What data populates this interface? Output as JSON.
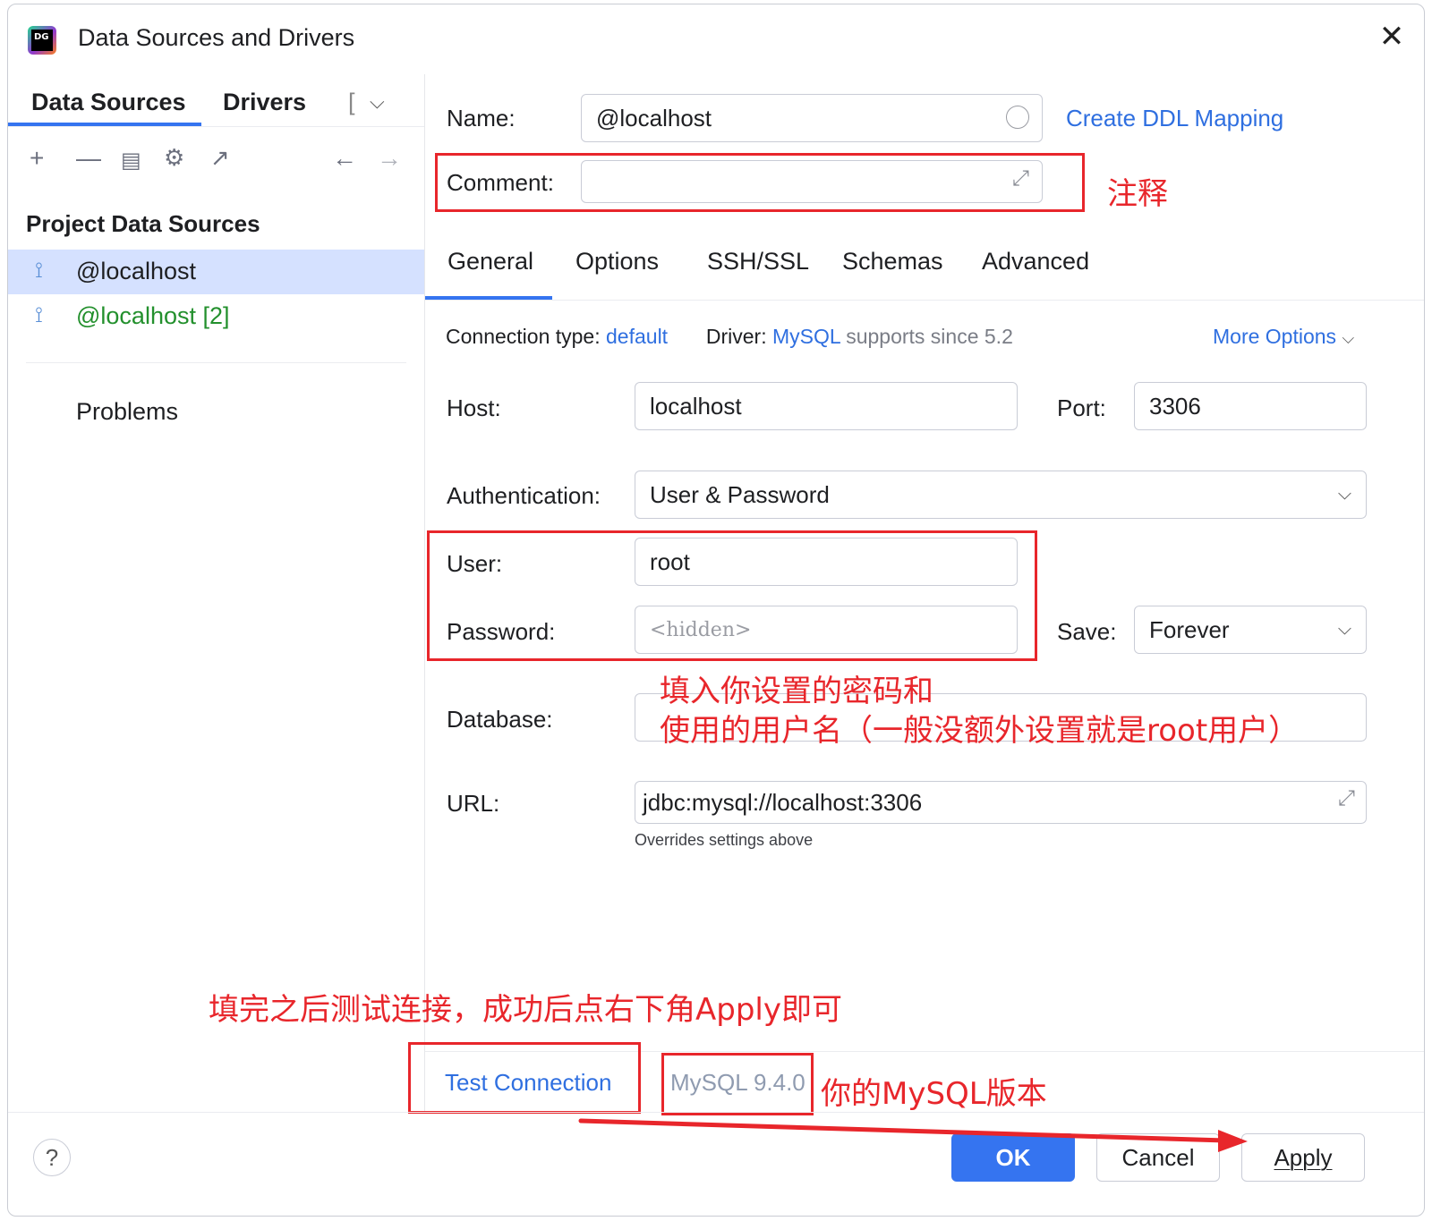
{
  "window": {
    "title": "Data Sources and Drivers",
    "app_icon_text": "DG"
  },
  "left": {
    "tabs": [
      "Data Sources",
      "Drivers",
      "["
    ],
    "section_title": "Project Data Sources",
    "items": [
      {
        "label": "@localhost",
        "selected": true
      },
      {
        "label": "@localhost [2]",
        "color": "#23902d"
      }
    ],
    "problems": "Problems"
  },
  "form": {
    "name_label": "Name:",
    "name_value": "@localhost",
    "create_ddl": "Create DDL Mapping",
    "comment_label": "Comment:",
    "comment_value": "",
    "tabs": [
      "General",
      "Options",
      "SSH/SSL",
      "Schemas",
      "Advanced"
    ],
    "conn_type_label": "Connection type:",
    "conn_type_value": "default",
    "driver_label": "Driver:",
    "driver_value": "MySQL",
    "driver_note": "supports since 5.2",
    "more_options": "More Options",
    "host_label": "Host:",
    "host_value": "localhost",
    "port_label": "Port:",
    "port_value": "3306",
    "auth_label": "Authentication:",
    "auth_value": "User & Password",
    "user_label": "User:",
    "user_value": "root",
    "password_label": "Password:",
    "password_placeholder": "<hidden>",
    "save_label": "Save:",
    "save_value": "Forever",
    "database_label": "Database:",
    "database_value": "",
    "url_label": "URL:",
    "url_value": "jdbc:mysql://localhost:3306",
    "url_hint": "Overrides settings above"
  },
  "annotations": {
    "comment_note": "注释",
    "credentials_note_line1": "填入你设置的密码和",
    "credentials_note_line2": "使用的用户名（一般没额外设置就是root用户）",
    "test_note": "填完之后测试连接，成功后点右下角Apply即可",
    "version_note": "你的MySQL版本"
  },
  "bottom": {
    "test_connection": "Test Connection",
    "mysql_version": "MySQL 9.4.0",
    "ok": "OK",
    "cancel": "Cancel",
    "apply": "Apply",
    "help": "?"
  },
  "colors": {
    "accent": "#3574f0",
    "link": "#2f6fe0",
    "annotation": "#e8262b"
  }
}
